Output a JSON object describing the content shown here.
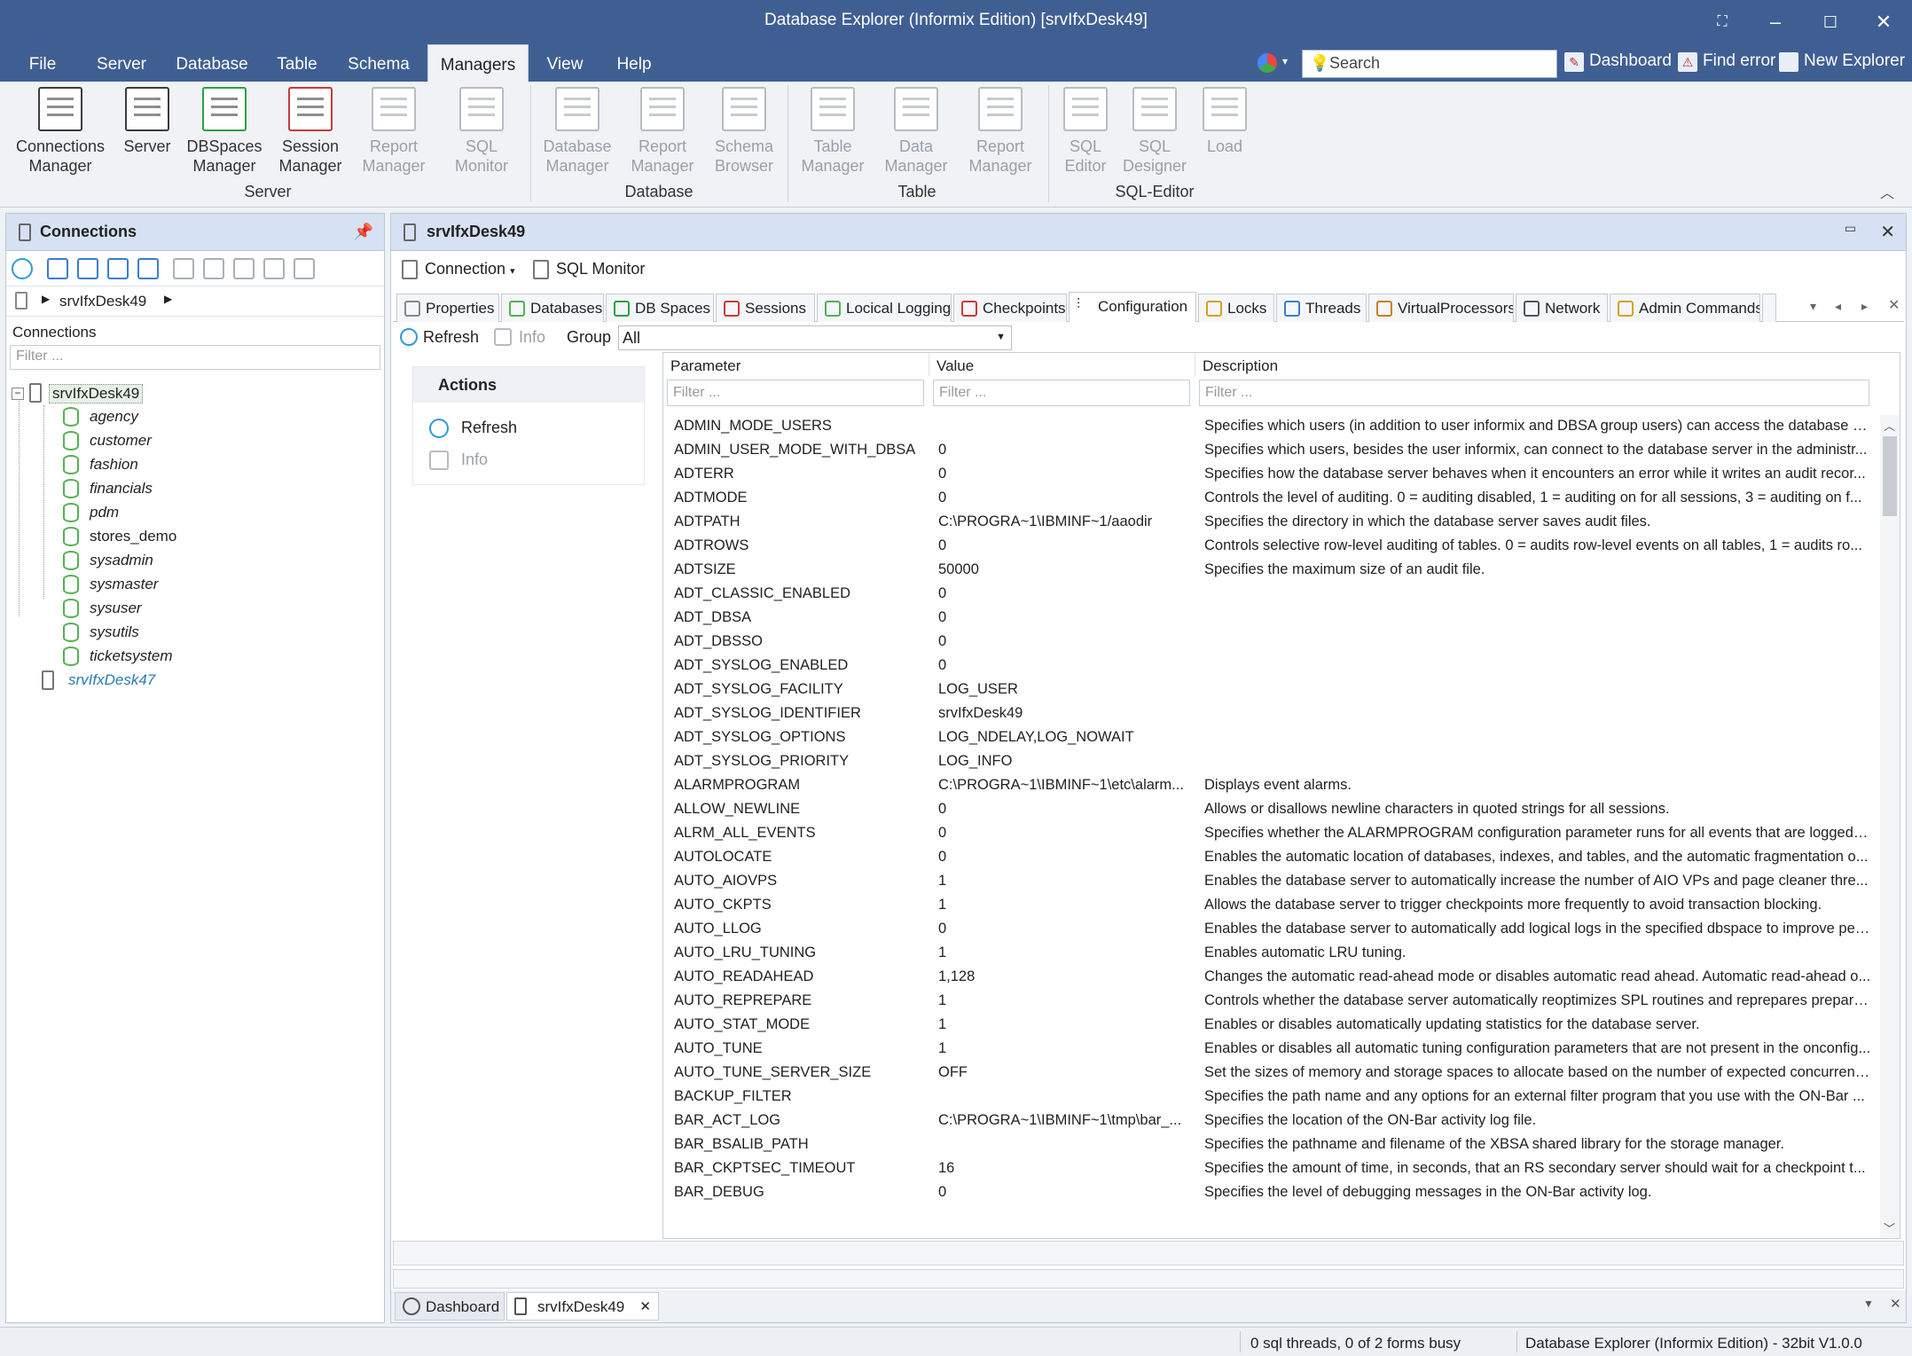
{
  "window": {
    "title": "Database Explorer (Informix Edition) [srvIfxDesk49]"
  },
  "menu": {
    "items": [
      "File",
      "Server",
      "Database",
      "Table",
      "Schema",
      "Managers",
      "View",
      "Help"
    ],
    "active": "Managers",
    "search_placeholder": "Search",
    "links": {
      "dashboard": "Dashboard",
      "find_error": "Find error",
      "new_explorer": "New Explorer"
    }
  },
  "ribbon": {
    "groups": {
      "server": "Server",
      "database": "Database",
      "table": "Table",
      "sql_editor": "SQL-Editor"
    },
    "buttons": {
      "connections_manager": "Connections Manager",
      "server": "Server",
      "dbspaces_manager": "DBSpaces Manager",
      "session_manager": "Session Manager",
      "report_manager_1": "Report Manager",
      "sql_monitor": "SQL Monitor",
      "database_manager": "Database Manager",
      "report_manager_2": "Report Manager",
      "schema_browser": "Schema Browser",
      "table_manager": "Table Manager",
      "data_manager": "Data Manager",
      "report_manager_3": "Report Manager",
      "sql_editor": "SQL Editor",
      "sql_designer": "SQL Designer",
      "load": "Load"
    }
  },
  "left": {
    "title": "Connections",
    "breadcrumb": "srvIfxDesk49",
    "section_label": "Connections",
    "filter_placeholder": "Filter ...",
    "tree": {
      "server1": "srvIfxDesk49",
      "databases": [
        "agency",
        "customer",
        "fashion",
        "financials",
        "pdm",
        "stores_demo",
        "sysadmin",
        "sysmaster",
        "sysuser",
        "sysutils",
        "ticketsystem"
      ],
      "server2": "srvIfxDesk47"
    }
  },
  "main": {
    "title": "srvIfxDesk49",
    "toolbar": {
      "connection": "Connection",
      "sql_monitor": "SQL Monitor"
    },
    "tabs": [
      "Properties",
      "Databases",
      "DB Spaces",
      "Sessions",
      "Locical Logging",
      "Checkpoints",
      "Configuration",
      "Locks",
      "Threads",
      "VirtualProcessors",
      "Network",
      "Admin Commands"
    ],
    "active_tab": "Configuration",
    "cfg_toolbar": {
      "refresh": "Refresh",
      "info": "Info",
      "group_label": "Group",
      "group_value": "All"
    },
    "actions": {
      "title": "Actions",
      "refresh": "Refresh",
      "info": "Info"
    },
    "grid": {
      "columns": [
        "Parameter",
        "Value",
        "Description"
      ],
      "filter_placeholder": "Filter ...",
      "rows": [
        [
          "ADMIN_MODE_USERS",
          "",
          "Specifies which users (in addition to user informix and DBSA group users) can access the database se..."
        ],
        [
          "ADMIN_USER_MODE_WITH_DBSA",
          "0",
          "Specifies which users, besides the user informix, can connect to the database server in the administr..."
        ],
        [
          "ADTERR",
          "0",
          "Specifies how the database server behaves when it encounters an error while it writes an audit recor..."
        ],
        [
          "ADTMODE",
          "0",
          "Controls the level of auditing. 0 = auditing disabled, 1 = auditing on for all sessions, 3 = auditing on f..."
        ],
        [
          "ADTPATH",
          "C:\\PROGRA~1\\IBMINF~1/aaodir",
          "Specifies the directory in which the database server saves audit files."
        ],
        [
          "ADTROWS",
          "0",
          "Controls selective row-level auditing of tables. 0 = audits row-level events on all tables, 1 = audits ro..."
        ],
        [
          "ADTSIZE",
          "50000",
          "Specifies the maximum size of an audit file."
        ],
        [
          "ADT_CLASSIC_ENABLED",
          "0",
          ""
        ],
        [
          "ADT_DBSA",
          "0",
          ""
        ],
        [
          "ADT_DBSSO",
          "0",
          ""
        ],
        [
          "ADT_SYSLOG_ENABLED",
          "0",
          ""
        ],
        [
          "ADT_SYSLOG_FACILITY",
          "LOG_USER",
          ""
        ],
        [
          "ADT_SYSLOG_IDENTIFIER",
          "srvIfxDesk49",
          ""
        ],
        [
          "ADT_SYSLOG_OPTIONS",
          "LOG_NDELAY,LOG_NOWAIT",
          ""
        ],
        [
          "ADT_SYSLOG_PRIORITY",
          "LOG_INFO",
          ""
        ],
        [
          "ALARMPROGRAM",
          "C:\\PROGRA~1\\IBMINF~1\\etc\\alarm...",
          "Displays event alarms."
        ],
        [
          "ALLOW_NEWLINE",
          "0",
          "Allows or disallows newline characters in quoted strings for all sessions."
        ],
        [
          "ALRM_ALL_EVENTS",
          "0",
          "Specifies whether the ALARMPROGRAM configuration parameter runs for all events that are logged i..."
        ],
        [
          "AUTOLOCATE",
          "0",
          "Enables the automatic location of databases, indexes, and tables, and the automatic fragmentation o..."
        ],
        [
          "AUTO_AIOVPS",
          "1",
          "Enables the database server to automatically increase the number of AIO VPs and page cleaner thre..."
        ],
        [
          "AUTO_CKPTS",
          "1",
          "Allows the database server to trigger checkpoints more frequently to avoid transaction blocking."
        ],
        [
          "AUTO_LLOG",
          "0",
          "Enables the database server to automatically add logical logs in the specified dbspace to improve perf..."
        ],
        [
          "AUTO_LRU_TUNING",
          "1",
          "Enables automatic LRU tuning."
        ],
        [
          "AUTO_READAHEAD",
          "1,128",
          "Changes the automatic read-ahead mode or disables automatic read ahead. Automatic read-ahead o..."
        ],
        [
          "AUTO_REPREPARE",
          "1",
          "Controls whether the database server automatically reoptimizes SPL routines and reprepares prepare..."
        ],
        [
          "AUTO_STAT_MODE",
          "1",
          "Enables or disables automatically updating statistics for the database server."
        ],
        [
          "AUTO_TUNE",
          "1",
          "Enables or disables all automatic tuning configuration parameters that are not present in the onconfig..."
        ],
        [
          "AUTO_TUNE_SERVER_SIZE",
          "OFF",
          "Set the sizes of memory and storage spaces to allocate based on the number of expected concurrent..."
        ],
        [
          "BACKUP_FILTER",
          "",
          "Specifies the path name and any options for an external filter program that you use with the ON-Bar ..."
        ],
        [
          "BAR_ACT_LOG",
          "C:\\PROGRA~1\\IBMINF~1\\tmp\\bar_...",
          "Specifies the location of the ON-Bar activity log file."
        ],
        [
          "BAR_BSALIB_PATH",
          "",
          "Specifies the pathname and filename of the XBSA shared library for the storage manager."
        ],
        [
          "BAR_CKPTSEC_TIMEOUT",
          "16",
          "Specifies the amount of time, in seconds, that an RS secondary server should wait for a checkpoint t..."
        ],
        [
          "BAR_DEBUG",
          "0",
          "Specifies the level of debugging messages in the ON-Bar activity log."
        ]
      ]
    },
    "doc_tabs": [
      "Dashboard",
      "srvIfxDesk49"
    ]
  },
  "status": {
    "threads": "0 sql threads, 0 of 2 forms busy",
    "app": "Database Explorer (Informix Edition) - 32bit V1.0.0"
  }
}
